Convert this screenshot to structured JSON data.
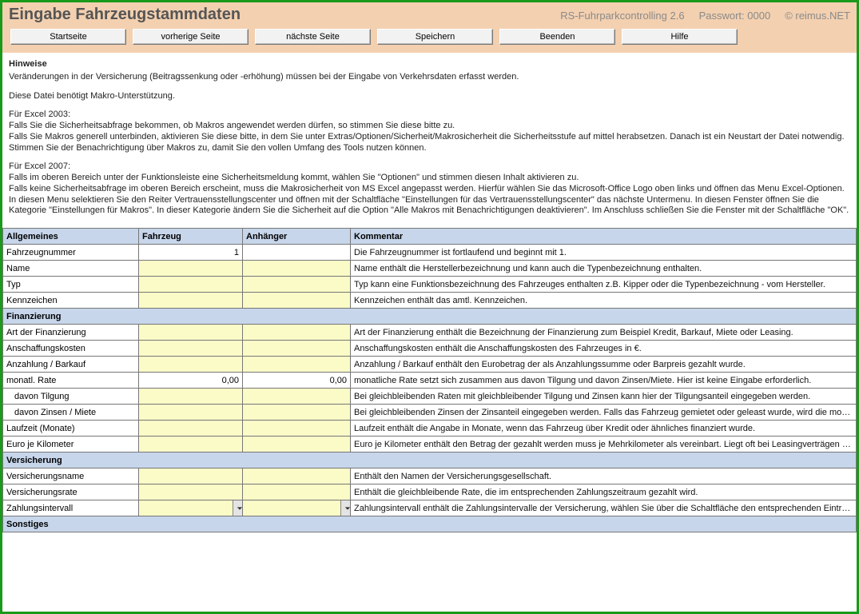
{
  "header": {
    "title": "Eingabe Fahrzeugstammdaten",
    "product": "RS-Fuhrparkcontrolling 2.6",
    "passwort_label": "Passwort: 0000",
    "copyright": "© reimus.NET"
  },
  "buttons": {
    "start": "Startseite",
    "prev": "vorherige Seite",
    "next": "nächste Seite",
    "save": "Speichern",
    "exit": "Beenden",
    "help": "Hilfe"
  },
  "hinweise": {
    "title": "Hinweise",
    "p1": "Veränderungen in der Versicherung (Beitragssenkung oder -erhöhung) müssen bei der Eingabe von Verkehrsdaten erfasst werden.",
    "p2": "Diese Datei benötigt Makro-Unterstützung.",
    "excel2003_h": "Für Excel 2003:",
    "excel2003_a": "Falls Sie die Sicherheitsabfrage bekommen, ob Makros angewendet werden dürfen, so stimmen Sie diese bitte zu.",
    "excel2003_b": "Falls Sie Makros generell unterbinden, aktivieren Sie diese bitte, in dem Sie unter Extras/Optionen/Sicherheit/Makrosicherheit die Sicherheitsstufe auf mittel herabsetzen. Danach ist ein Neustart der Datei notwendig. Stimmen Sie der Benachrichtigung über Makros zu, damit Sie den vollen Umfang des Tools nutzen können.",
    "excel2007_h": "Für Excel 2007:",
    "excel2007_a": "Falls im oberen Bereich unter der Funktionsleiste eine Sicherheitsmeldung kommt, wählen Sie \"Optionen\" und stimmen diesen Inhalt aktivieren zu.",
    "excel2007_b": "Falls keine Sicherheitsabfrage im oberen Bereich erscheint, muss die Makrosicherheit von MS Excel angepasst werden. Hierfür wählen Sie das Microsoft-Office Logo oben links und öffnen das Menu Excel-Optionen. In diesen Menu selektieren Sie den Reiter Vertrauensstellungscenter und öffnen mit der Schaltfläche \"Einstellungen für das Vertrauensstellungscenter\" das nächste Untermenu. In diesen Fenster öffnen Sie die Kategorie \"Einstellungen für Makros\". In dieser Kategorie ändern Sie die Sicherheit auf die Option \"Alle Makros mit Benachrichtigungen deaktivieren\". Im Anschluss schließen Sie die Fenster mit der Schaltfläche \"OK\"."
  },
  "sections": {
    "allgemeines": {
      "h1": "Allgemeines",
      "h2": "Fahrzeug",
      "h3": "Anhänger",
      "h4": "Kommentar"
    },
    "finanzierung": "Finanzierung",
    "versicherung": "Versicherung",
    "sonstiges": "Sonstiges"
  },
  "rows": {
    "fahrzeugnummer": {
      "label": "Fahrzeugnummer",
      "fahrzeug": "1",
      "anhaenger": "",
      "comment": "Die Fahrzeugnummer ist fortlaufend und beginnt mit 1."
    },
    "name": {
      "label": "Name",
      "comment": "Name enthält die Herstellerbezeichnung und kann auch die Typenbezeichnung enthalten."
    },
    "typ": {
      "label": "Typ",
      "comment": "Typ kann eine Funktionsbezeichnung des Fahrzeuges enthalten z.B. Kipper oder die Typenbezeichnung - vom Hersteller."
    },
    "kennzeichen": {
      "label": "Kennzeichen",
      "comment": "Kennzeichen enthält das amtl. Kennzeichen."
    },
    "art_fin": {
      "label": "Art der Finanzierung",
      "comment": "Art der Finanzierung enthält die Bezeichnung der Finanzierung zum Beispiel Kredit, Barkauf, Miete oder Leasing."
    },
    "anschaffung": {
      "label": "Anschaffungskosten",
      "comment": "Anschaffungskosten enthält die Anschaffungskosten des Fahrzeuges in €."
    },
    "anzahlung": {
      "label": "Anzahlung / Barkauf",
      "comment": "Anzahlung / Barkauf enthält den Eurobetrag der als Anzahlungssumme oder Barpreis gezahlt wurde."
    },
    "monatl_rate": {
      "label": "monatl. Rate",
      "fahrzeug": "0,00",
      "anhaenger": "0,00",
      "comment": "monatliche Rate setzt sich zusammen aus davon Tilgung und davon Zinsen/Miete. Hier ist keine Eingabe erforderlich."
    },
    "tilgung": {
      "label": "davon Tilgung",
      "comment": "Bei gleichbleibenden Raten mit gleichbleibender Tilgung und Zinsen kann hier der Tilgungsanteil eingegeben werden."
    },
    "zinsen": {
      "label": "davon Zinsen / Miete",
      "comment": "Bei gleichbleibenden Zinsen der Zinsanteil eingegeben werden. Falls das Fahrzeug gemietet oder geleast wurde, wird die monatl. Rate eingetragen."
    },
    "laufzeit": {
      "label": "Laufzeit (Monate)",
      "comment": "Laufzeit enthält die Angabe in Monate, wenn das Fahrzeug über Kredit oder ähnliches finanziert wurde."
    },
    "euro_km": {
      "label": "Euro je Kilometer",
      "comment": "Euro je Kilometer enthält den Betrag der gezahlt werden muss je Mehrkilometer als vereinbart. Liegt oft bei Leasingverträgen vor."
    },
    "vers_name": {
      "label": "Versicherungsname",
      "comment": "Enthält den Namen der Versicherungsgesellschaft."
    },
    "vers_rate": {
      "label": "Versicherungsrate",
      "comment": "Enthält die gleichbleibende Rate, die im entsprechenden Zahlungszeitraum gezahlt wird."
    },
    "zahl_intervall": {
      "label": "Zahlungsintervall",
      "comment": "Zahlungsintervall enthält die Zahlungsintervalle der Versicherung, wählen Sie über die Schaltfläche den entsprechenden Eintrag."
    }
  }
}
